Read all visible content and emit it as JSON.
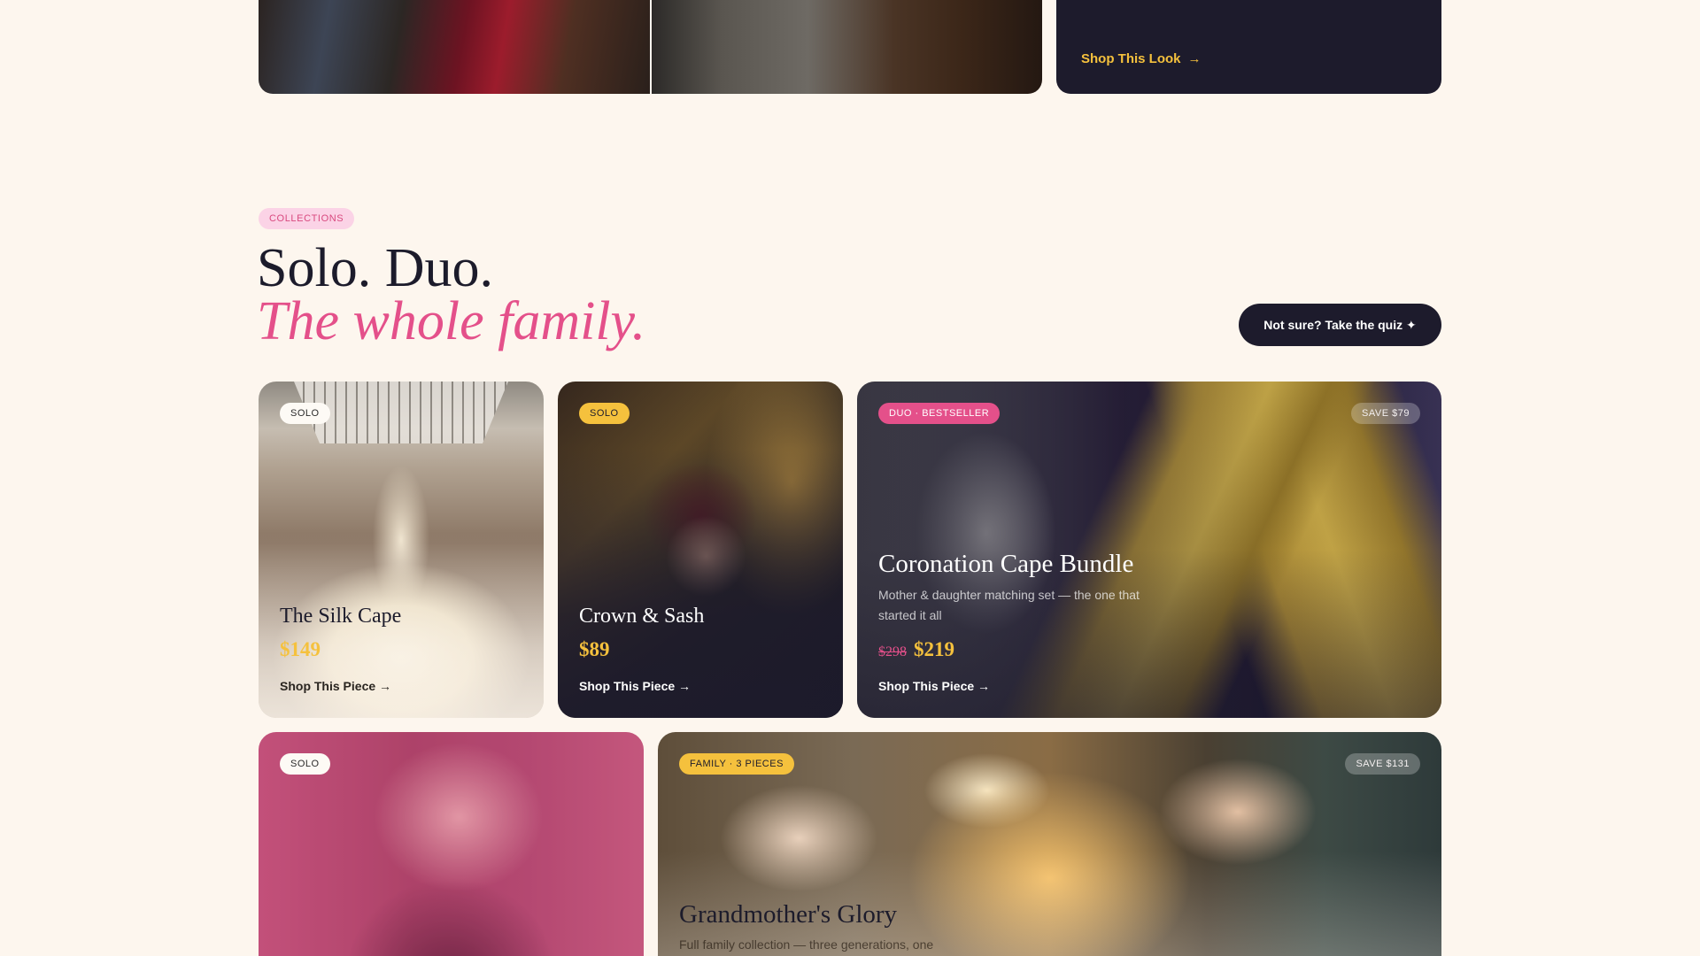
{
  "top": {
    "shop_look_label": "Shop This Look",
    "arrow": "→"
  },
  "section": {
    "badge": "COLLECTIONS",
    "heading_line1": "Solo. Duo.",
    "heading_line2": "The whole family.",
    "quiz_button": "Not sure? Take the quiz ✦"
  },
  "cards": [
    {
      "tag": "SOLO",
      "title": "The Silk Cape",
      "price": "$149",
      "cta": "Shop This Piece →"
    },
    {
      "tag": "SOLO",
      "title": "Crown & Sash",
      "price": "$89",
      "cta": "Shop This Piece →"
    },
    {
      "tag": "DUO · BESTSELLER",
      "save": "SAVE $79",
      "title": "Coronation Cape Bundle",
      "description": "Mother & daughter matching set — the one that started it all",
      "old_price": "$298",
      "price": "$219",
      "cta": "Shop This Piece →"
    },
    {
      "tag": "SOLO"
    },
    {
      "tag": "FAMILY · 3 PIECES",
      "save": "SAVE $131",
      "title": "Grandmother's Glory",
      "description": "Full family collection — three generations, one"
    }
  ],
  "colors": {
    "background": "#fdf6ee",
    "navy": "#1d1b2c",
    "gold": "#f5c13d",
    "pink": "#e4508a",
    "pink_light": "#fbd3e6"
  }
}
